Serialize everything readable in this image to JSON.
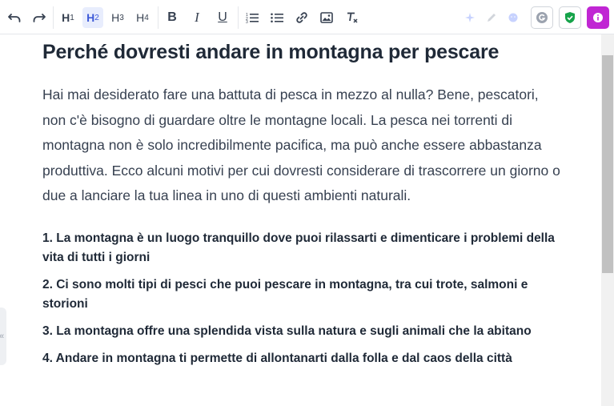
{
  "toolbar": {
    "undo_icon": "undo-icon",
    "redo_icon": "redo-icon",
    "headings": [
      {
        "main": "H",
        "sub": "1"
      },
      {
        "main": "H",
        "sub": "2"
      },
      {
        "main": "H",
        "sub": "3"
      },
      {
        "main": "H",
        "sub": "4"
      }
    ],
    "active_heading": "H2",
    "format_buttons": [
      "B",
      "I",
      "U"
    ],
    "accent_color": "#3f5bd8",
    "badge_colors": {
      "shield": "#16a34a",
      "info": "#c026d3",
      "grammar": "#9ca3af"
    }
  },
  "document": {
    "title": "Perché dovresti andare in montagna per pescare",
    "intro": "Hai mai desiderato fare una battuta di pesca in mezzo al nulla? Bene, pescatori, non c'è bisogno di guardare oltre le montagne locali. La pesca nei torrenti di montagna non è solo incredibilmente pacifica, ma può anche essere abbastanza produttiva. Ecco alcuni motivi per cui dovresti considerare di trascorrere un giorno o due a lanciare la tua linea in uno di questi ambienti naturali.",
    "points": [
      "1. La montagna è un luogo tranquillo dove puoi rilassarti e dimenticare i problemi della vita di tutti i giorni",
      "2. Ci sono molti tipi di pesci che puoi pescare in montagna, tra cui trote, salmoni e storioni",
      "3. La montagna offre una splendida vista sulla natura e sugli animali che la abitano",
      "4. Andare in montagna ti permette di allontanarti dalla folla e dal caos della città"
    ]
  },
  "side_tab": {
    "label": "«"
  }
}
